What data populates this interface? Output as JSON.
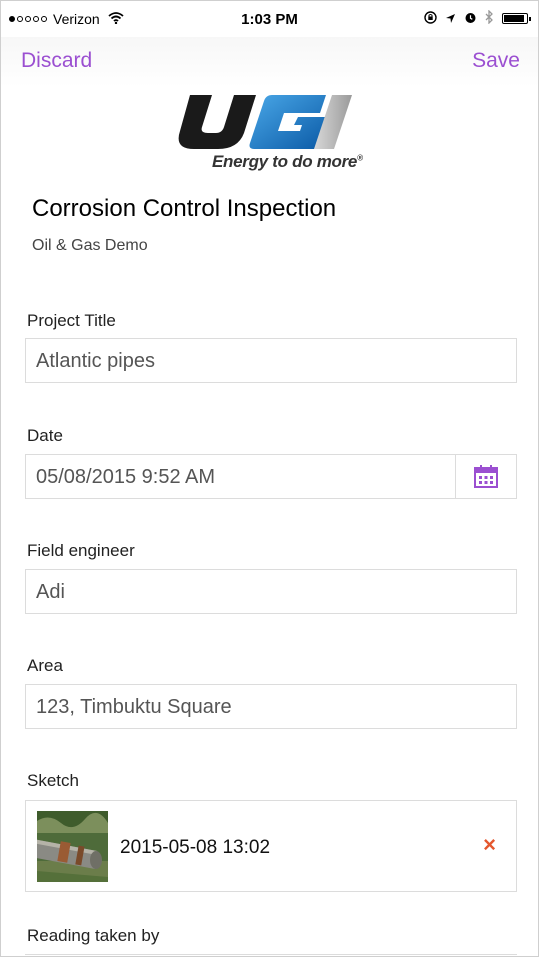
{
  "status_bar": {
    "carrier": "Verizon",
    "time": "1:03 PM"
  },
  "nav": {
    "discard_label": "Discard",
    "save_label": "Save"
  },
  "logo": {
    "tagline": "Energy to do more",
    "trademark": "®",
    "brand": "UGI"
  },
  "form": {
    "title": "Corrosion Control Inspection",
    "subtitle": "Oil & Gas Demo"
  },
  "fields": {
    "project_title": {
      "label": "Project Title",
      "value": "Atlantic pipes"
    },
    "date": {
      "label": "Date",
      "value": "05/08/2015 9:52 AM"
    },
    "field_engineer": {
      "label": "Field engineer",
      "value": "Adi"
    },
    "area": {
      "label": "Area",
      "value": "123, Timbuktu Square"
    },
    "sketch": {
      "label": "Sketch",
      "file_name": "2015-05-08 13:02",
      "remove_icon": "×"
    },
    "reading_taken_by": {
      "label": "Reading taken by"
    }
  },
  "colors": {
    "accent": "#9b4fd1",
    "remove": "#e4572e"
  }
}
